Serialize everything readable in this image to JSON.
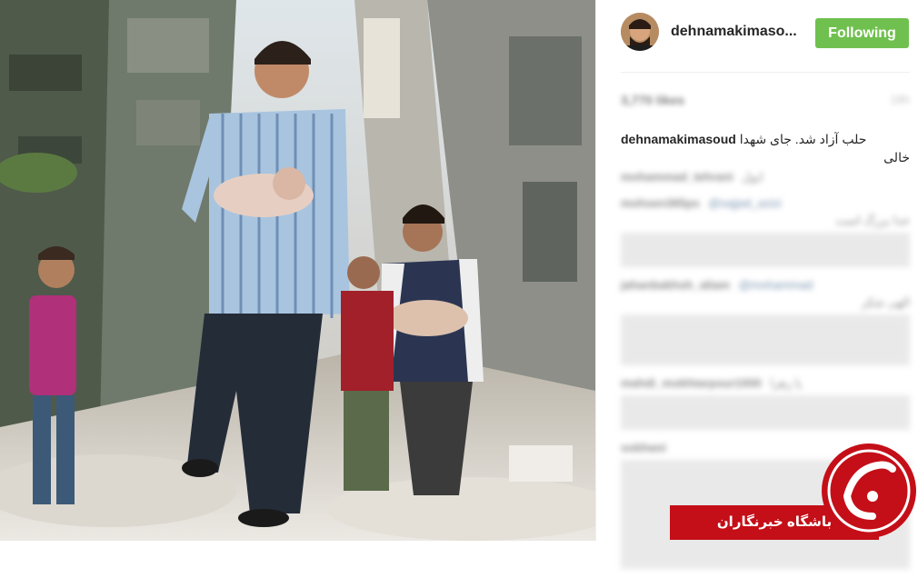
{
  "post": {
    "photo_alt": "photo"
  },
  "header": {
    "username": "dehnamakimaso...",
    "follow_label": "Following"
  },
  "meta": {
    "likes": "3,770 likes",
    "date": "18h"
  },
  "caption": {
    "username": "dehnamakimasoud",
    "text_line1": "حلب آزاد شد. جای شهدا",
    "text_line2": "خالی"
  },
  "comments": [
    {
      "user": "mohammad_tehrani",
      "mention": "",
      "text": "ایول"
    },
    {
      "user": "mohsen365ps",
      "mention": "@sajjad_azizi",
      "text": "خدا بزرگ است"
    },
    {
      "user": "jahanbakhsh_aliam",
      "mention": "@mohammad",
      "text": "الهی شکر"
    },
    {
      "user": "",
      "mention": "",
      "text": ""
    },
    {
      "user": "mahdi_mokhtarpour1000",
      "mention": "",
      "text": "یا زهرا"
    },
    {
      "user": "sobhani",
      "mention": "",
      "text": ""
    },
    {
      "user": "",
      "mention": "",
      "text": ""
    }
  ],
  "watermark": {
    "brand_text": "باشگاه خبرنگاران",
    "brand_color": "#c40f18"
  },
  "colors": {
    "follow_button": "#70c050",
    "text": "#262626"
  }
}
